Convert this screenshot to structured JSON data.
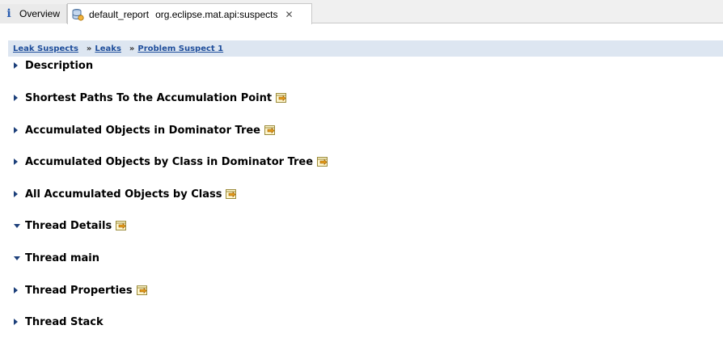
{
  "tabs": [
    {
      "label": "Overview",
      "icon": "info-icon"
    },
    {
      "label": "default_report",
      "sublabel": "org.eclipse.mat.api:suspects",
      "icon": "database-icon",
      "close": "✕"
    }
  ],
  "breadcrumb": {
    "items": [
      "Leak Suspects",
      "Leaks",
      "Problem Suspect 1"
    ],
    "separator": "»"
  },
  "sections": [
    {
      "title": "Description",
      "state": "collapsed",
      "has_query_icon": false
    },
    {
      "title": "Shortest Paths To the Accumulation Point",
      "state": "collapsed",
      "has_query_icon": true
    },
    {
      "title": "Accumulated Objects in Dominator Tree",
      "state": "collapsed",
      "has_query_icon": true
    },
    {
      "title": "Accumulated Objects by Class in Dominator Tree",
      "state": "collapsed",
      "has_query_icon": true
    },
    {
      "title": "All Accumulated Objects by Class",
      "state": "collapsed",
      "has_query_icon": true
    },
    {
      "title": "Thread Details",
      "state": "expanded",
      "has_query_icon": true
    },
    {
      "title": "Thread main",
      "state": "expanded",
      "has_query_icon": false
    },
    {
      "title": "Thread Properties",
      "state": "collapsed",
      "has_query_icon": true
    },
    {
      "title": "Thread Stack",
      "state": "collapsed",
      "has_query_icon": false
    }
  ],
  "colors": {
    "breadcrumb_bg": "#dde6f1",
    "link": "#1f4e9b",
    "twisty": "#1c3f7a"
  }
}
